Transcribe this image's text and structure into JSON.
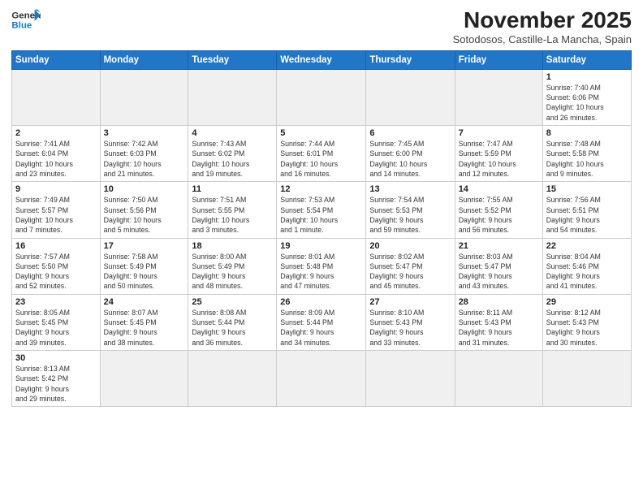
{
  "header": {
    "logo_general": "General",
    "logo_blue": "Blue",
    "title": "November 2025",
    "subtitle": "Sotodosos, Castille-La Mancha, Spain"
  },
  "weekdays": [
    "Sunday",
    "Monday",
    "Tuesday",
    "Wednesday",
    "Thursday",
    "Friday",
    "Saturday"
  ],
  "weeks": [
    [
      {
        "day": "",
        "info": ""
      },
      {
        "day": "",
        "info": ""
      },
      {
        "day": "",
        "info": ""
      },
      {
        "day": "",
        "info": ""
      },
      {
        "day": "",
        "info": ""
      },
      {
        "day": "",
        "info": ""
      },
      {
        "day": "1",
        "info": "Sunrise: 7:40 AM\nSunset: 6:06 PM\nDaylight: 10 hours\nand 26 minutes."
      }
    ],
    [
      {
        "day": "2",
        "info": "Sunrise: 7:41 AM\nSunset: 6:04 PM\nDaylight: 10 hours\nand 23 minutes."
      },
      {
        "day": "3",
        "info": "Sunrise: 7:42 AM\nSunset: 6:03 PM\nDaylight: 10 hours\nand 21 minutes."
      },
      {
        "day": "4",
        "info": "Sunrise: 7:43 AM\nSunset: 6:02 PM\nDaylight: 10 hours\nand 19 minutes."
      },
      {
        "day": "5",
        "info": "Sunrise: 7:44 AM\nSunset: 6:01 PM\nDaylight: 10 hours\nand 16 minutes."
      },
      {
        "day": "6",
        "info": "Sunrise: 7:45 AM\nSunset: 6:00 PM\nDaylight: 10 hours\nand 14 minutes."
      },
      {
        "day": "7",
        "info": "Sunrise: 7:47 AM\nSunset: 5:59 PM\nDaylight: 10 hours\nand 12 minutes."
      },
      {
        "day": "8",
        "info": "Sunrise: 7:48 AM\nSunset: 5:58 PM\nDaylight: 10 hours\nand 9 minutes."
      }
    ],
    [
      {
        "day": "9",
        "info": "Sunrise: 7:49 AM\nSunset: 5:57 PM\nDaylight: 10 hours\nand 7 minutes."
      },
      {
        "day": "10",
        "info": "Sunrise: 7:50 AM\nSunset: 5:56 PM\nDaylight: 10 hours\nand 5 minutes."
      },
      {
        "day": "11",
        "info": "Sunrise: 7:51 AM\nSunset: 5:55 PM\nDaylight: 10 hours\nand 3 minutes."
      },
      {
        "day": "12",
        "info": "Sunrise: 7:53 AM\nSunset: 5:54 PM\nDaylight: 10 hours\nand 1 minute."
      },
      {
        "day": "13",
        "info": "Sunrise: 7:54 AM\nSunset: 5:53 PM\nDaylight: 9 hours\nand 59 minutes."
      },
      {
        "day": "14",
        "info": "Sunrise: 7:55 AM\nSunset: 5:52 PM\nDaylight: 9 hours\nand 56 minutes."
      },
      {
        "day": "15",
        "info": "Sunrise: 7:56 AM\nSunset: 5:51 PM\nDaylight: 9 hours\nand 54 minutes."
      }
    ],
    [
      {
        "day": "16",
        "info": "Sunrise: 7:57 AM\nSunset: 5:50 PM\nDaylight: 9 hours\nand 52 minutes."
      },
      {
        "day": "17",
        "info": "Sunrise: 7:58 AM\nSunset: 5:49 PM\nDaylight: 9 hours\nand 50 minutes."
      },
      {
        "day": "18",
        "info": "Sunrise: 8:00 AM\nSunset: 5:49 PM\nDaylight: 9 hours\nand 48 minutes."
      },
      {
        "day": "19",
        "info": "Sunrise: 8:01 AM\nSunset: 5:48 PM\nDaylight: 9 hours\nand 47 minutes."
      },
      {
        "day": "20",
        "info": "Sunrise: 8:02 AM\nSunset: 5:47 PM\nDaylight: 9 hours\nand 45 minutes."
      },
      {
        "day": "21",
        "info": "Sunrise: 8:03 AM\nSunset: 5:47 PM\nDaylight: 9 hours\nand 43 minutes."
      },
      {
        "day": "22",
        "info": "Sunrise: 8:04 AM\nSunset: 5:46 PM\nDaylight: 9 hours\nand 41 minutes."
      }
    ],
    [
      {
        "day": "23",
        "info": "Sunrise: 8:05 AM\nSunset: 5:45 PM\nDaylight: 9 hours\nand 39 minutes."
      },
      {
        "day": "24",
        "info": "Sunrise: 8:07 AM\nSunset: 5:45 PM\nDaylight: 9 hours\nand 38 minutes."
      },
      {
        "day": "25",
        "info": "Sunrise: 8:08 AM\nSunset: 5:44 PM\nDaylight: 9 hours\nand 36 minutes."
      },
      {
        "day": "26",
        "info": "Sunrise: 8:09 AM\nSunset: 5:44 PM\nDaylight: 9 hours\nand 34 minutes."
      },
      {
        "day": "27",
        "info": "Sunrise: 8:10 AM\nSunset: 5:43 PM\nDaylight: 9 hours\nand 33 minutes."
      },
      {
        "day": "28",
        "info": "Sunrise: 8:11 AM\nSunset: 5:43 PM\nDaylight: 9 hours\nand 31 minutes."
      },
      {
        "day": "29",
        "info": "Sunrise: 8:12 AM\nSunset: 5:43 PM\nDaylight: 9 hours\nand 30 minutes."
      }
    ],
    [
      {
        "day": "30",
        "info": "Sunrise: 8:13 AM\nSunset: 5:42 PM\nDaylight: 9 hours\nand 29 minutes."
      },
      {
        "day": "",
        "info": ""
      },
      {
        "day": "",
        "info": ""
      },
      {
        "day": "",
        "info": ""
      },
      {
        "day": "",
        "info": ""
      },
      {
        "day": "",
        "info": ""
      },
      {
        "day": "",
        "info": ""
      }
    ]
  ]
}
